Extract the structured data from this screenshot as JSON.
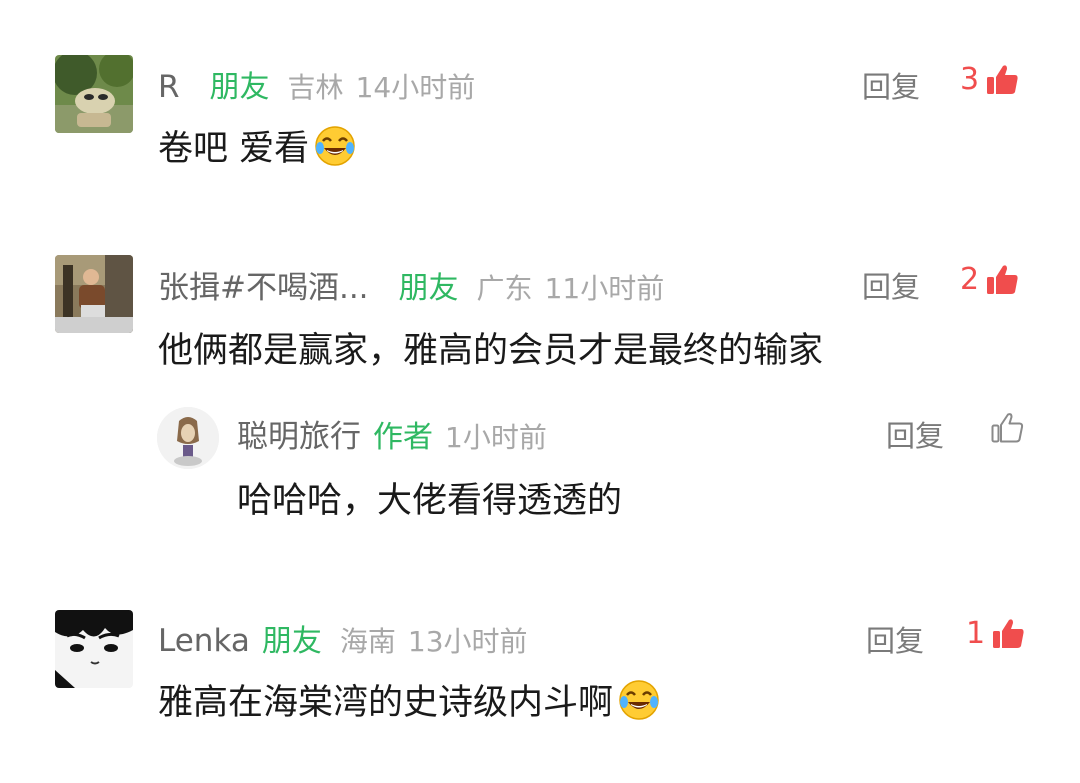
{
  "comments": [
    {
      "name": "R",
      "tag": "朋友",
      "location": "吉林",
      "time": "14小时前",
      "text": "卷吧 爱看",
      "reply_label": "回复",
      "likes": "3"
    },
    {
      "name": "张揖#不喝酒...",
      "tag": "朋友",
      "location": "广东",
      "time": "11小时前",
      "text": "他俩都是赢家，雅高的会员才是最终的输家",
      "reply_label": "回复",
      "likes": "2",
      "reply": {
        "name": "聪明旅行",
        "tag": "作者",
        "time": "1小时前",
        "text": "哈哈哈，大佬看得透透的",
        "reply_label": "回复"
      }
    },
    {
      "name": "Lenka",
      "tag": "朋友",
      "location": "海南",
      "time": "13小时前",
      "text": "雅高在海棠湾的史诗级内斗啊",
      "reply_label": "回复",
      "likes": "1"
    }
  ],
  "colors": {
    "tag_green": "#2fb862",
    "like_red": "#f04d4d",
    "name_gray": "#666666",
    "meta_gray": "#a8a8a8"
  },
  "icons": {
    "liked": "thumbs-up-filled-icon",
    "unliked": "thumbs-up-outline-icon",
    "emoji": "tears-of-joy-emoji"
  }
}
